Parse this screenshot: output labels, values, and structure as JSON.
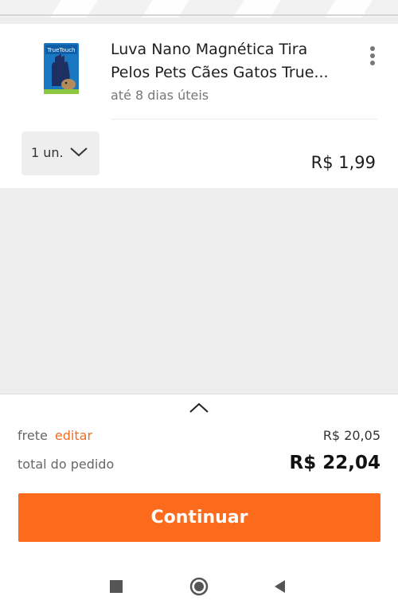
{
  "product": {
    "title_line1": "Luva Nano Magnética Tira",
    "title_line2": "Pelos Pets Cães Gatos True...",
    "delivery": "até 8 dias úteis",
    "thumbnail_brand": "TrueTouch",
    "price": "R$ 1,99"
  },
  "quantity": {
    "label": "1 un."
  },
  "summary": {
    "frete_label": "frete",
    "frete_edit": "editar",
    "frete_value": "R$ 20,05",
    "total_label": "total do pedido",
    "total_value": "R$ 22,04",
    "continue_label": "Continuar"
  },
  "colors": {
    "accent": "#fc6a1c",
    "link": "#f26c22"
  },
  "icons": {
    "menu": "more-vert-icon",
    "quantity_dropdown": "chevron-down-icon",
    "expand": "chevron-up-icon",
    "nav_recents": "square-icon",
    "nav_home": "circle-icon",
    "nav_back": "triangle-back-icon"
  }
}
